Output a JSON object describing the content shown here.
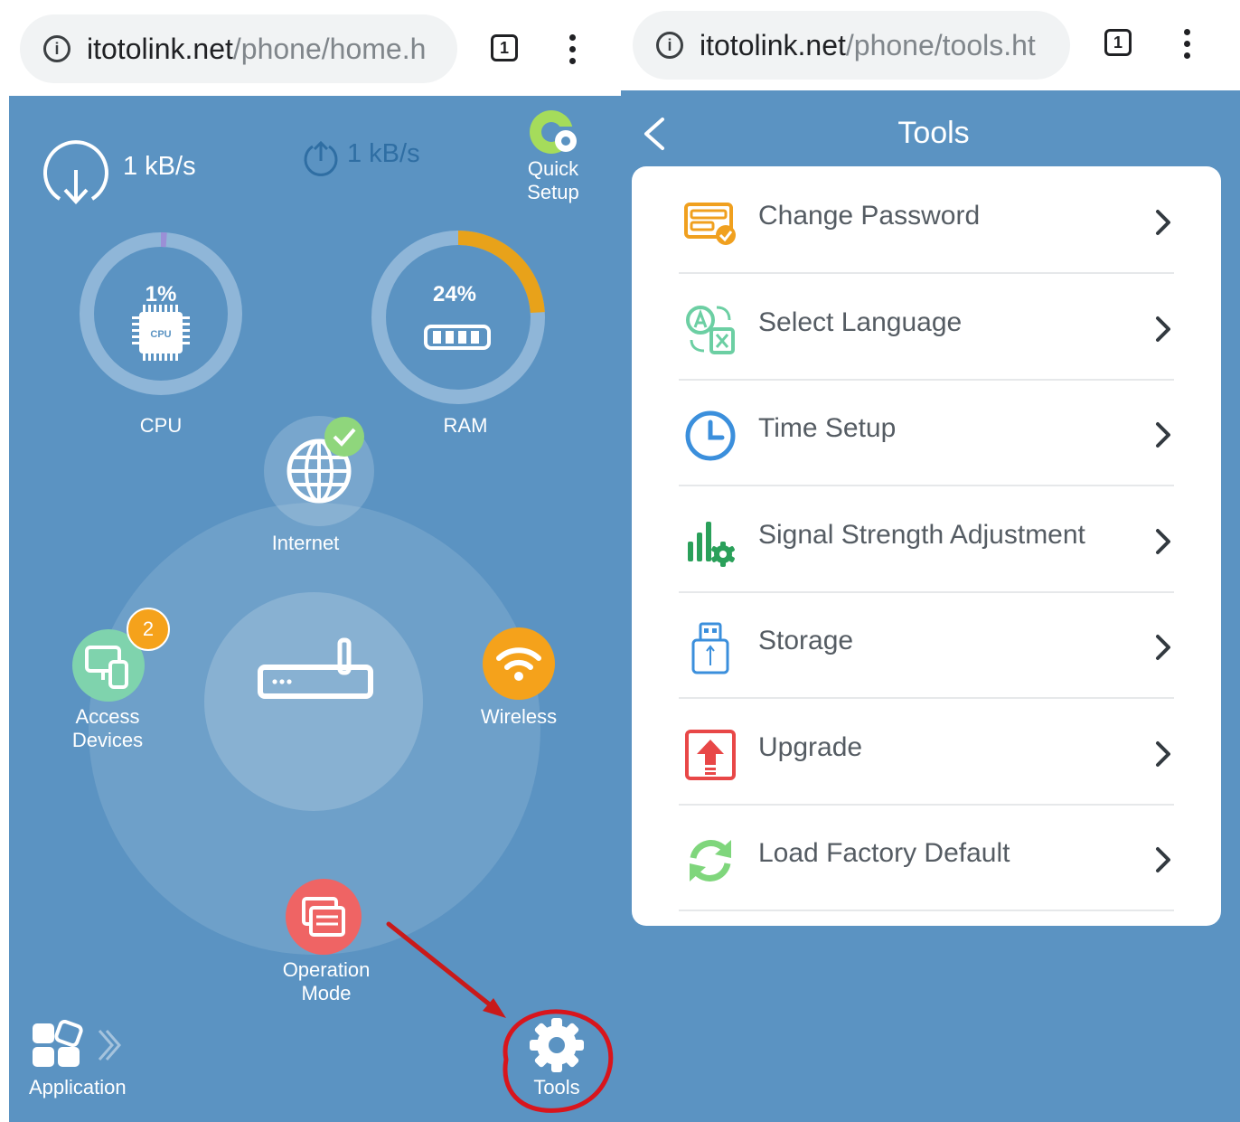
{
  "left_screen": {
    "browser": {
      "url_host": "itotolink.net",
      "url_path": "/phone/home.h",
      "tab_count": "1"
    },
    "download_speed": "1 kB/s",
    "upload_speed": "1 kB/s",
    "quick_setup_label_1": "Quick",
    "quick_setup_label_2": "Setup",
    "cpu": {
      "label": "CPU",
      "percent_text": "1%",
      "chip_text": "CPU",
      "value": 0.01
    },
    "ram": {
      "label": "RAM",
      "percent_text": "24%",
      "value": 0.24
    },
    "internet_label": "Internet",
    "access_devices_label_1": "Access",
    "access_devices_label_2": "Devices",
    "access_devices_badge": "2",
    "wireless_label": "Wireless",
    "operation_mode_label_1": "Operation",
    "operation_mode_label_2": "Mode",
    "application_label": "Application",
    "tools_label": "Tools"
  },
  "right_screen": {
    "browser": {
      "url_host": "itotolink.net",
      "url_path": "/phone/tools.ht",
      "tab_count": "1"
    },
    "title": "Tools",
    "menu": [
      {
        "label": "Change Password",
        "icon": "password-icon"
      },
      {
        "label": "Select Language",
        "icon": "language-icon"
      },
      {
        "label": "Time Setup",
        "icon": "clock-icon"
      },
      {
        "label": "Signal Strength Adjustment",
        "icon": "signal-gear-icon"
      },
      {
        "label": "Storage",
        "icon": "usb-storage-icon"
      },
      {
        "label": "Upgrade",
        "icon": "upgrade-icon"
      },
      {
        "label": "Load Factory Default",
        "icon": "refresh-icon"
      }
    ]
  },
  "colors": {
    "panel_bg": "#5b93c2",
    "ring_track": "#8fb6d8",
    "cpu_fill": "#9b8fd6",
    "ram_fill": "#e8a21a",
    "accent_orange": "#f5a21b",
    "accent_green": "#7fd3ad",
    "accent_red": "#ef6464",
    "annotation_red": "#d8151c"
  }
}
